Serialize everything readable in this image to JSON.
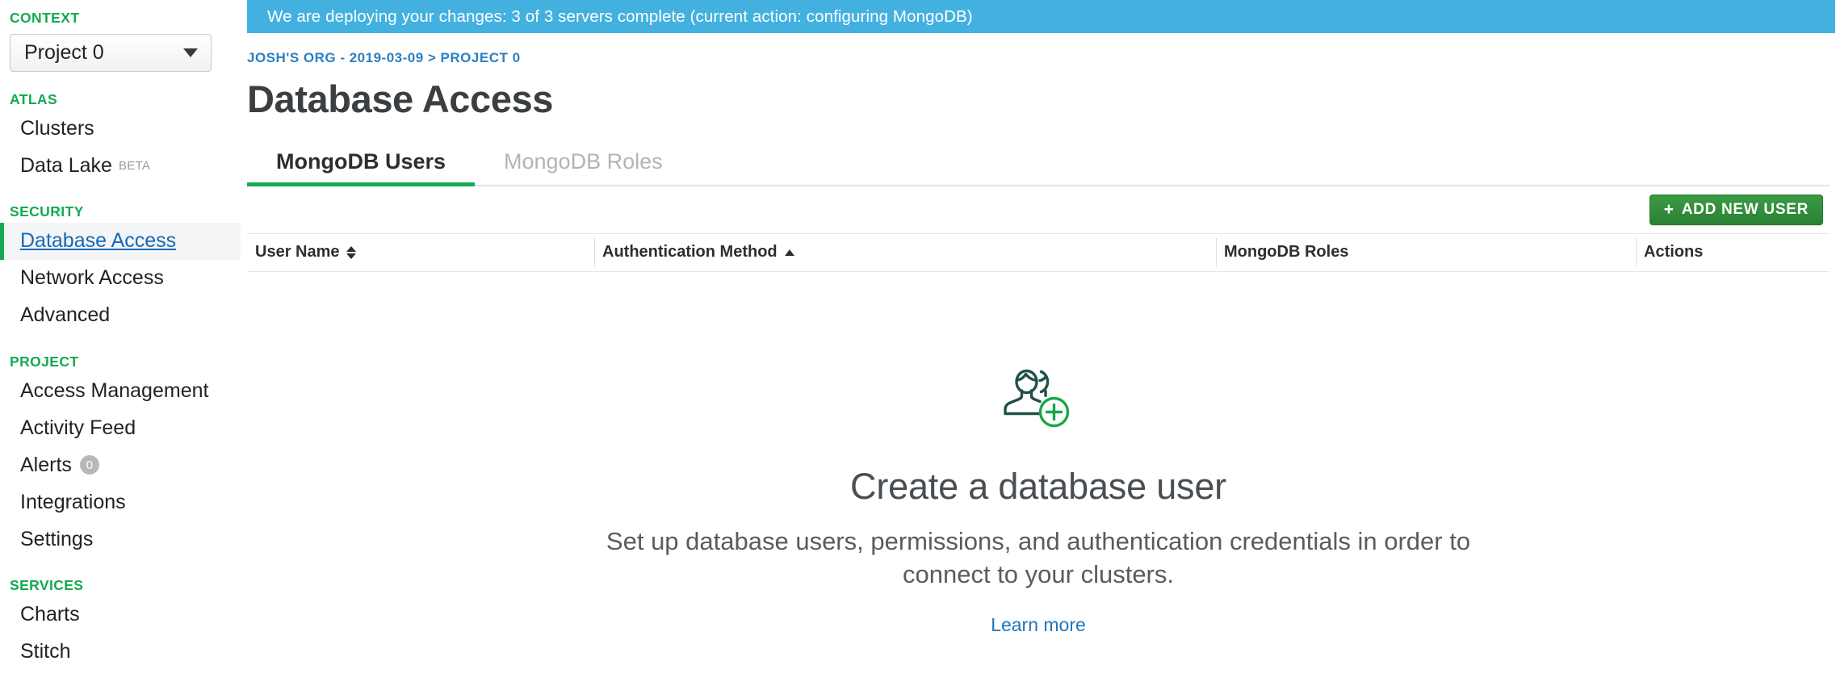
{
  "sidebar": {
    "context": {
      "label": "CONTEXT",
      "selected_project": "Project 0",
      "caret_icon": "chevron-down-icon"
    },
    "groups": [
      {
        "label": "ATLAS",
        "items": [
          {
            "label": "Clusters",
            "tag": "",
            "badge": "",
            "active": false
          },
          {
            "label": "Data Lake",
            "tag": "BETA",
            "badge": "",
            "active": false
          }
        ]
      },
      {
        "label": "SECURITY",
        "items": [
          {
            "label": "Database Access",
            "tag": "",
            "badge": "",
            "active": true
          },
          {
            "label": "Network Access",
            "tag": "",
            "badge": "",
            "active": false
          },
          {
            "label": "Advanced",
            "tag": "",
            "badge": "",
            "active": false
          }
        ]
      },
      {
        "label": "PROJECT",
        "items": [
          {
            "label": "Access Management",
            "tag": "",
            "badge": "",
            "active": false
          },
          {
            "label": "Activity Feed",
            "tag": "",
            "badge": "",
            "active": false
          },
          {
            "label": "Alerts",
            "tag": "",
            "badge": "0",
            "active": false
          },
          {
            "label": "Integrations",
            "tag": "",
            "badge": "",
            "active": false
          },
          {
            "label": "Settings",
            "tag": "",
            "badge": "",
            "active": false
          }
        ]
      },
      {
        "label": "SERVICES",
        "items": [
          {
            "label": "Charts",
            "tag": "",
            "badge": "",
            "active": false
          },
          {
            "label": "Stitch",
            "tag": "",
            "badge": "",
            "active": false
          }
        ]
      }
    ]
  },
  "banner": {
    "message": "We are deploying your changes: 3 of 3 servers complete (current action: configuring MongoDB)",
    "color": "#43b1e0"
  },
  "header": {
    "breadcrumb": "JOSH'S ORG - 2019-03-09 > PROJECT 0",
    "title": "Database Access"
  },
  "tabs": [
    {
      "label": "MongoDB Users",
      "active": true
    },
    {
      "label": "MongoDB Roles",
      "active": false
    }
  ],
  "toolbar": {
    "add_user_label": "ADD NEW USER",
    "add_user_plus": "+",
    "add_user_color": "#3a9b42"
  },
  "table": {
    "columns": [
      {
        "label": "User Name",
        "sort": "both"
      },
      {
        "label": "Authentication Method",
        "sort": "asc"
      },
      {
        "label": "MongoDB Roles",
        "sort": "none"
      },
      {
        "label": "Actions",
        "sort": "none"
      }
    ],
    "rows": []
  },
  "empty_state": {
    "icon": "add-user-icon",
    "title": "Create a database user",
    "description": "Set up database users, permissions, and authentication credentials in order to connect to your clusters.",
    "link_label": "Learn more"
  },
  "accent_colors": {
    "green": "#13aa52",
    "link_blue": "#1f77bd",
    "breadcrumb_blue": "#2a7fc3"
  }
}
